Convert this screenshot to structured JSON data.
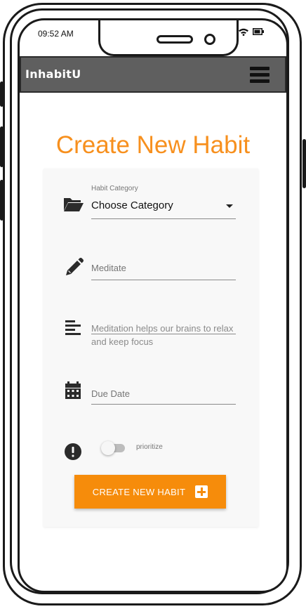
{
  "status_bar": {
    "time": "09:52 AM",
    "icons": [
      "signal-icon",
      "wifi-icon",
      "battery-icon"
    ]
  },
  "app_bar": {
    "title": "InhabitU",
    "menu_icon": "hamburger-menu-icon"
  },
  "page": {
    "title": "Create New Habit"
  },
  "form": {
    "category": {
      "label": "Habit Category",
      "value": "Choose Category",
      "icon": "folder-open-icon"
    },
    "name": {
      "placeholder": "Meditate",
      "icon": "pencil-icon"
    },
    "description": {
      "placeholder": "Meditation helps our brains to relax and keep focus",
      "icon": "notes-icon"
    },
    "due_date": {
      "placeholder": "Due Date",
      "icon": "calendar-icon"
    },
    "prioritize": {
      "label": "prioritize",
      "checked": false,
      "icon": "exclamation-circle-icon"
    },
    "submit": {
      "label": "CREATE NEW HABIT",
      "icon": "plus-box-icon"
    }
  },
  "colors": {
    "accent": "#f68c0b",
    "app_bar": "#5f5f5f"
  }
}
